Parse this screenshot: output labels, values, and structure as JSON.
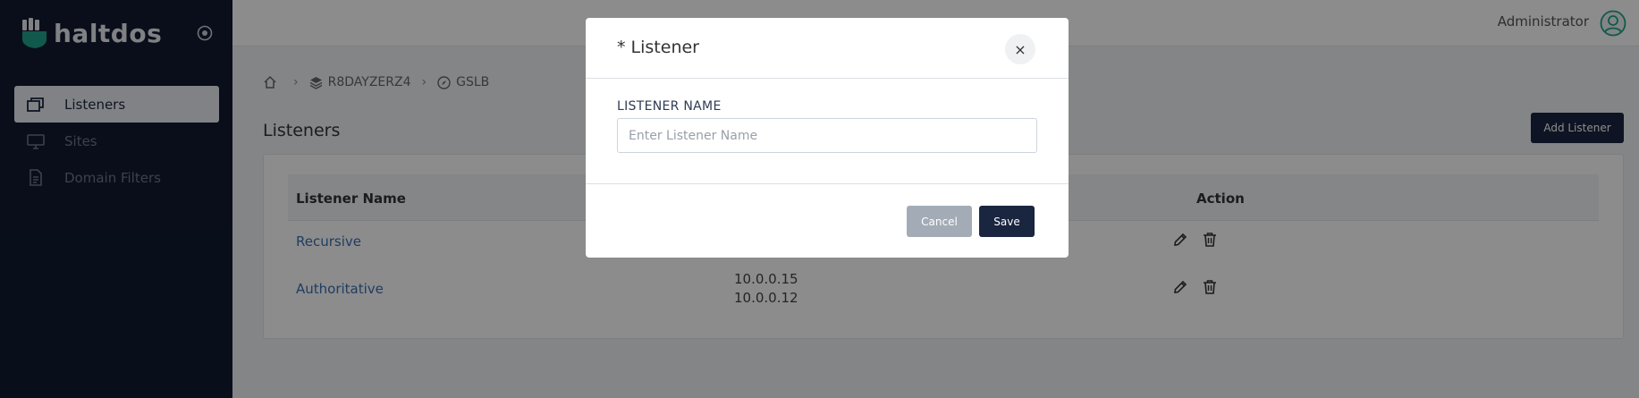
{
  "brand": {
    "name": "haltdos"
  },
  "sidebar": {
    "items": [
      {
        "label": "Listeners",
        "icon": "windows-icon",
        "active": true
      },
      {
        "label": "Sites",
        "icon": "monitor-icon",
        "active": false
      },
      {
        "label": "Domain Filters",
        "icon": "document-icon",
        "active": false
      }
    ]
  },
  "header": {
    "user_name": "Administrator",
    "user_icon": "user-avatar-icon"
  },
  "breadcrumb": {
    "items": [
      "R8DAYZERZ4",
      "GSLB"
    ],
    "separator": "›"
  },
  "page": {
    "title": "Listeners",
    "add_button": "Add Listener"
  },
  "table": {
    "columns": [
      "Listener Name",
      "Action"
    ],
    "rows": [
      {
        "name": "Recursive",
        "ips": []
      },
      {
        "name": "Authoritative",
        "ips": [
          "10.0.0.15",
          "10.0.0.12"
        ]
      }
    ]
  },
  "modal": {
    "title": "* Listener",
    "close_label": "×",
    "field_label": "LISTENER NAME",
    "field_placeholder": "Enter Listener Name",
    "field_value": "",
    "cancel_label": "Cancel",
    "save_label": "Save"
  },
  "colors": {
    "sidebar_bg": "#111b30",
    "primary_button": "#1a2540",
    "link": "#3a6fb0",
    "cancel_button": "#a3abb7"
  }
}
